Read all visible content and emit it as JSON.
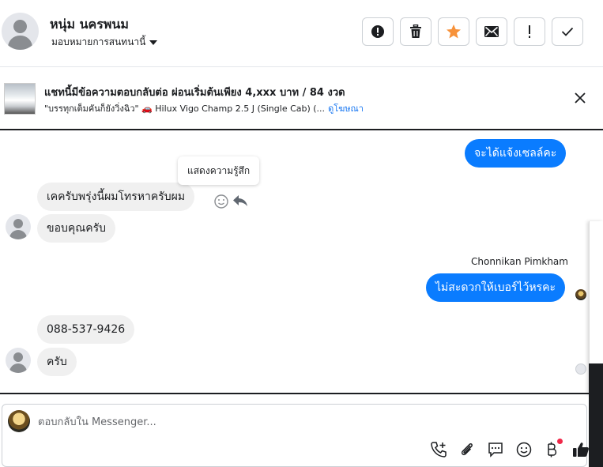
{
  "header": {
    "contact_name": "หนุ่ม นครพนม",
    "assign_label": "มอบหมายการสนทนานี้"
  },
  "ad": {
    "title": "แชทนี้มีข้อความตอบกลับต่อ ผ่อนเริ่มต้นเพียง 4,xxx บาท / 84 งวด",
    "subtitle": "\"บรรทุกเต็มคันก็ยังวิ่งฉิว\" 🚗 Hilux Vigo Champ 2.5 J (Single Cab) (...",
    "link_label": "ดูโฆษณา"
  },
  "chat": {
    "messages": [
      {
        "text": "จะได้แจ้งเซลล์คะ",
        "direction": "out"
      },
      {
        "text": "เคครับพรุ่งนี้ผมโทรหาครับผม",
        "direction": "in"
      },
      {
        "text": "ขอบคุณครับ",
        "direction": "in"
      },
      {
        "text": "ไม่สะดวกให้เบอร์ไว้หรคะ",
        "direction": "out",
        "sender": "Chonnikan Pimkham"
      },
      {
        "text": "088-537-9426",
        "direction": "in"
      },
      {
        "text": "ครับ",
        "direction": "in"
      }
    ],
    "tooltip": "แสดงความรู้สึก"
  },
  "composer": {
    "placeholder": "ตอบกลับใน Messenger..."
  },
  "colors": {
    "accent": "#0a7cff",
    "incoming_bubble": "#f0f0f0",
    "link": "#1877f2",
    "star": "#f7923a",
    "notification_dot": "#f02849"
  },
  "icons": {
    "header_actions": [
      "alert-circle-icon",
      "trash-icon",
      "star-icon",
      "envelope-icon",
      "exclamation-icon",
      "check-icon"
    ],
    "toolbar": [
      "add-call-icon",
      "paperclip-icon",
      "saved-reply-icon",
      "emoji-icon",
      "baht-icon",
      "thumbs-up-icon"
    ]
  }
}
